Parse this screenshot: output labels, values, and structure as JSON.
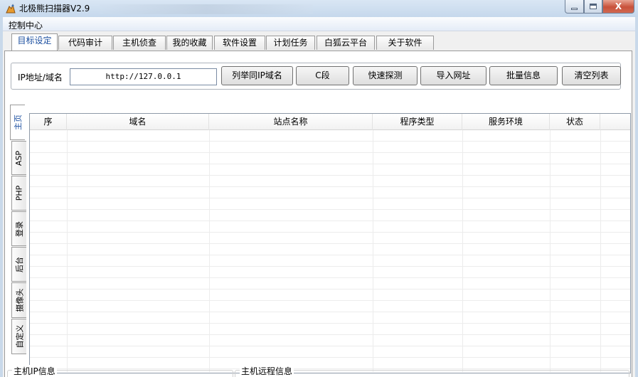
{
  "window": {
    "title": "北极熊扫描器V2.9",
    "close_glyph": "X"
  },
  "menu": {
    "items": [
      "控制中心"
    ]
  },
  "tabs": [
    {
      "label": "目标设定",
      "active": true
    },
    {
      "label": "代码审计"
    },
    {
      "label": "主机侦查"
    },
    {
      "label": "我的收藏"
    },
    {
      "label": "软件设置"
    },
    {
      "label": "计划任务"
    },
    {
      "label": "白狐云平台"
    },
    {
      "label": "关于软件"
    }
  ],
  "toolbar": {
    "ip_label": "IP地址/域名",
    "url_value": "http://127.0.0.1",
    "buttons": [
      "列举同IP域名",
      "C段",
      "快速探测",
      "导入网址",
      "批量信息",
      "清空列表"
    ]
  },
  "side_tabs": [
    {
      "label": "主页",
      "active": true
    },
    {
      "label": "ASP"
    },
    {
      "label": "PHP"
    },
    {
      "label": "登录"
    },
    {
      "label": "后台"
    },
    {
      "label": "摄像头"
    },
    {
      "label": "自定义"
    }
  ],
  "grid": {
    "columns": [
      "序",
      "域名",
      "站点名称",
      "程序类型",
      "服务环境",
      "状态"
    ]
  },
  "groups": {
    "host_ip": "主机IP信息",
    "host_remote": "主机远程信息"
  },
  "colors": {
    "active_tab_text": "#1c4fa0",
    "close_button": "#c8513a"
  }
}
